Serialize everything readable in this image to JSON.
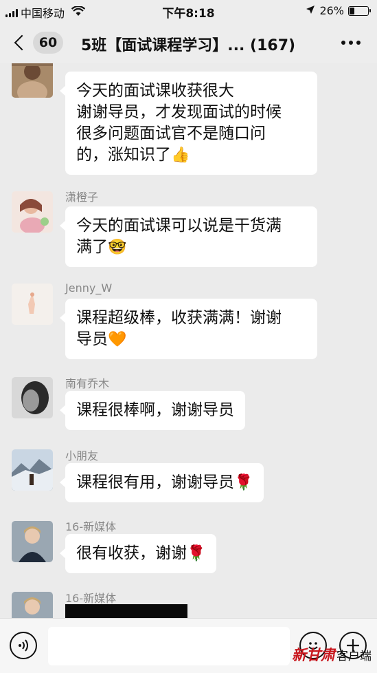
{
  "status_bar": {
    "carrier": "中国移动",
    "time": "下午8:18",
    "battery_percent": "26%",
    "battery_level": 0.26,
    "icons": [
      "signal-icon",
      "wifi-icon",
      "location-icon",
      "battery-icon"
    ]
  },
  "nav": {
    "unread_count": "60",
    "title": "5班【面试课程学习】... (167)"
  },
  "messages": [
    {
      "sender": "",
      "text": "今天的面试课收获很大\n谢谢导员，才发现面试的时候\n很多问题面试官不是随口问\n的，涨知识了",
      "emoji": "👍"
    },
    {
      "sender": "潇橙子",
      "text": "今天的面试课可以说是干货满\n满了",
      "emoji": "🤓"
    },
    {
      "sender": "Jenny_W",
      "text": "课程超级棒，收获满满！谢谢\n导员",
      "emoji": "🧡"
    },
    {
      "sender": "南有乔木",
      "text": "课程很棒啊，谢谢导员",
      "emoji": ""
    },
    {
      "sender": "小朋友",
      "text": "课程很有用，谢谢导员",
      "emoji": "🌹"
    },
    {
      "sender": "16-新媒体",
      "text": "很有收获，谢谢",
      "emoji": "🌹"
    },
    {
      "sender": "16-新媒体",
      "text": "",
      "emoji": ""
    }
  ],
  "watermark": {
    "logo": "新甘肃",
    "text": "客户端"
  },
  "colors": {
    "background": "#ebebeb",
    "bubble": "#ffffff",
    "sender_text": "#888888",
    "watermark_red": "#c8161d"
  }
}
